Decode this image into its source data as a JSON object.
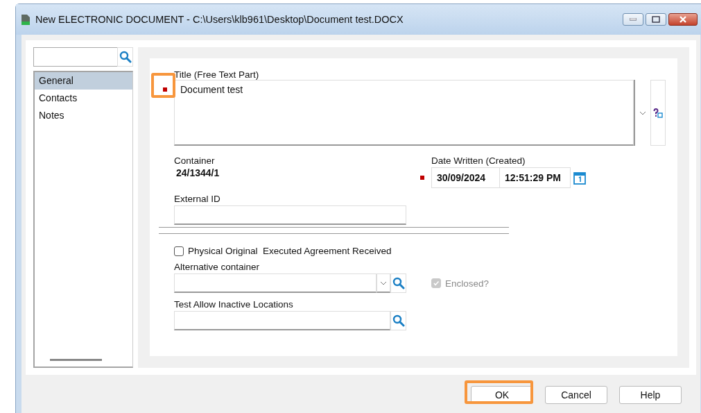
{
  "window": {
    "title": "New ELECTRONIC DOCUMENT - C:\\Users\\klb961\\Desktop\\Document test.DOCX"
  },
  "sidebar": {
    "items": [
      {
        "label": "General",
        "selected": true
      },
      {
        "label": "Contacts",
        "selected": false
      },
      {
        "label": "Notes",
        "selected": false
      }
    ]
  },
  "form": {
    "title_field": {
      "label": "Title (Free Text Part)",
      "value": "Document test",
      "required": true,
      "highlighted": true
    },
    "container": {
      "label": "Container",
      "value": "24/1344/1"
    },
    "date_written": {
      "label": "Date Written (Created)",
      "date": "30/09/2024",
      "time": "12:51:29 PM",
      "required": true
    },
    "external_id": {
      "label": "External ID"
    },
    "physical_original": {
      "label": "Physical Original  Executed Agreement Received",
      "checked": false
    },
    "alternative_container": {
      "label": "Alternative container"
    },
    "enclosed": {
      "label": "Enclosed?",
      "checked": true,
      "disabled": true
    },
    "test_allow_inactive_locations": {
      "label": "Test Allow Inactive Locations"
    }
  },
  "buttons": [
    {
      "label": "OK",
      "highlighted": true
    },
    {
      "label": "Cancel",
      "highlighted": false
    },
    {
      "label": "Help",
      "highlighted": false
    }
  ]
}
